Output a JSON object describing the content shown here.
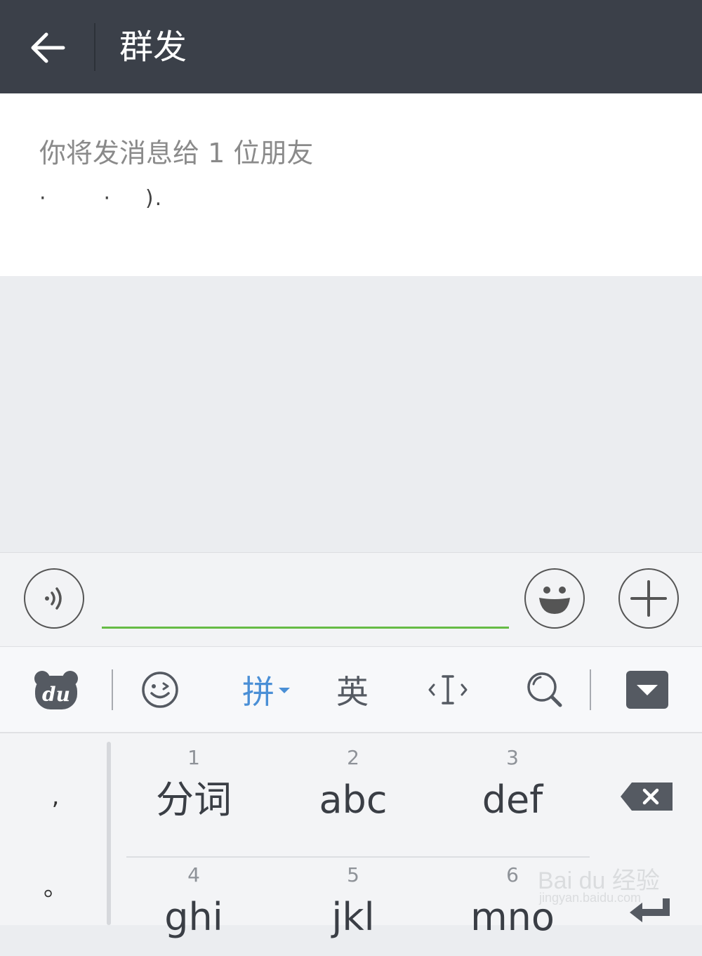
{
  "header": {
    "title": "群发"
  },
  "recipients": {
    "summary": "你将发消息给 1 位朋友",
    "names": "·          ·      )."
  },
  "input_bar": {
    "message_value": ""
  },
  "keyboard": {
    "toolbar": {
      "logo_text": "du",
      "pinyin_label": "拼",
      "english_label": "英"
    },
    "punctuation": [
      ",",
      "。"
    ],
    "keys": [
      {
        "num": "1",
        "label": "分词"
      },
      {
        "num": "2",
        "label": "abc"
      },
      {
        "num": "3",
        "label": "def"
      },
      {
        "num": "4",
        "label": "ghi"
      },
      {
        "num": "5",
        "label": "jkl"
      },
      {
        "num": "6",
        "label": "mno"
      }
    ]
  },
  "watermark": {
    "brand": "Bai du 经验",
    "url": "jingyan.baidu.com"
  },
  "colors": {
    "header_bg": "#3b4049",
    "accent_green": "#66bb45",
    "pinyin_blue": "#4a8fd6"
  }
}
